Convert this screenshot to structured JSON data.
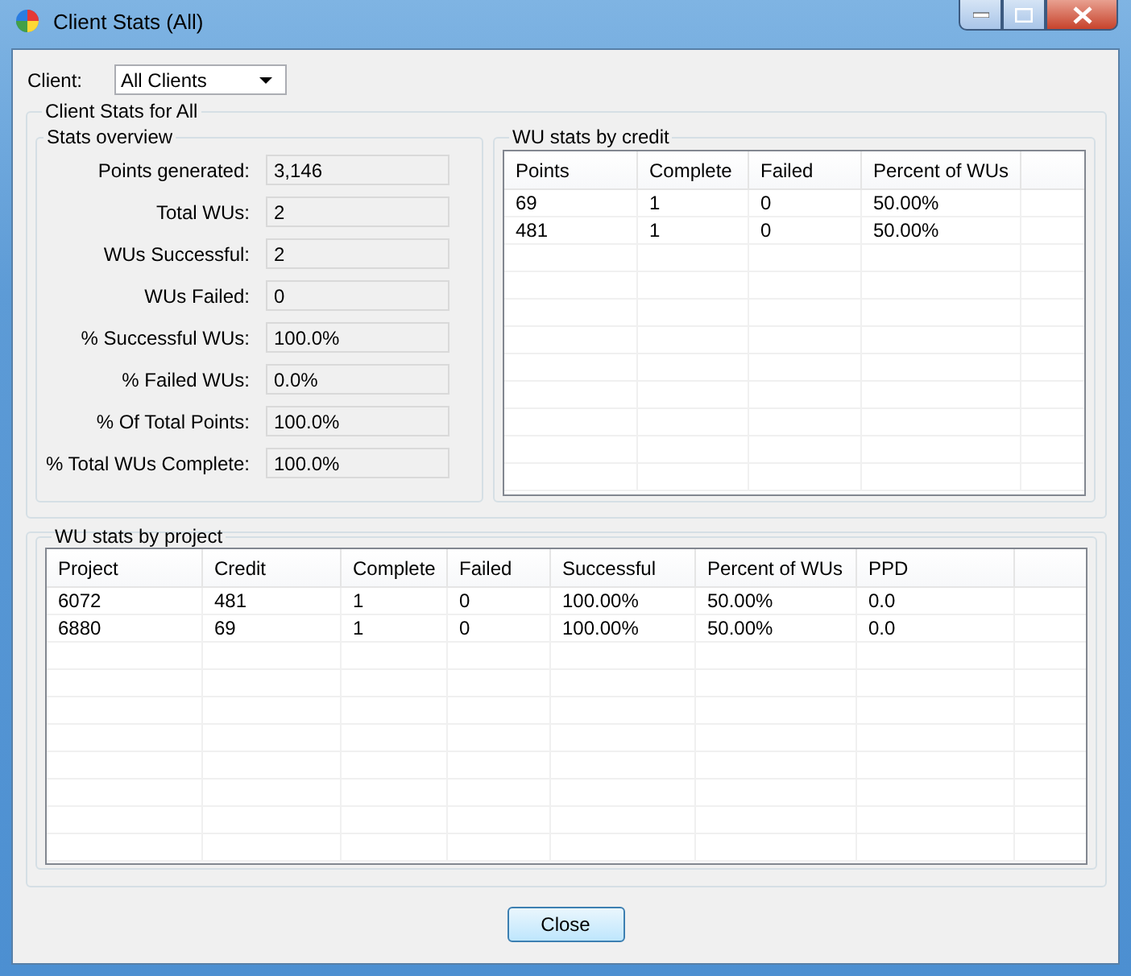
{
  "window": {
    "title": "Client Stats (All)"
  },
  "client": {
    "label": "Client:",
    "value": "All Clients"
  },
  "summary_group": {
    "title": "Client Stats for All"
  },
  "stats_overview": {
    "title": "Stats overview",
    "fields": [
      {
        "label": "Points generated:",
        "value": "3,146"
      },
      {
        "label": "Total WUs:",
        "value": "2"
      },
      {
        "label": "WUs Successful:",
        "value": "2"
      },
      {
        "label": "WUs Failed:",
        "value": "0"
      },
      {
        "label": "% Successful WUs:",
        "value": "100.0%"
      },
      {
        "label": "% Failed WUs:",
        "value": "0.0%"
      },
      {
        "label": "% Of Total Points:",
        "value": "100.0%"
      },
      {
        "label": "% Total WUs Complete:",
        "value": "100.0%"
      }
    ]
  },
  "credit_table": {
    "title": "WU stats by credit",
    "columns": [
      "Points",
      "Complete",
      "Failed",
      "Percent of WUs"
    ],
    "rows": [
      [
        "69",
        "1",
        "0",
        "50.00%"
      ],
      [
        "481",
        "1",
        "0",
        "50.00%"
      ]
    ]
  },
  "project_table": {
    "title": "WU stats by project",
    "columns": [
      "Project",
      "Credit",
      "Complete",
      "Failed",
      "Successful",
      "Percent of WUs",
      "PPD"
    ],
    "rows": [
      [
        "6072",
        "481",
        "1",
        "0",
        "100.00%",
        "50.00%",
        "0.0"
      ],
      [
        "6880",
        "69",
        "1",
        "0",
        "100.00%",
        "50.00%",
        "0.0"
      ]
    ]
  },
  "buttons": [
    "Close"
  ]
}
